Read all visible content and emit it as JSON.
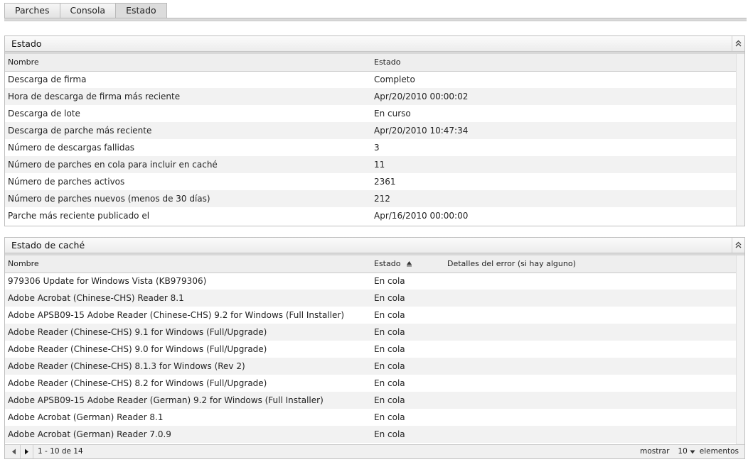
{
  "tabs": [
    {
      "label": "Parches",
      "active": false
    },
    {
      "label": "Consola",
      "active": false
    },
    {
      "label": "Estado",
      "active": true
    }
  ],
  "status_panel": {
    "title": "Estado",
    "columns": [
      "Nombre",
      "Estado"
    ],
    "rows": [
      {
        "name": "Descarga de firma",
        "status": "Completo"
      },
      {
        "name": "Hora de descarga de firma más reciente",
        "status": "Apr/20/2010 00:00:02"
      },
      {
        "name": "Descarga de lote",
        "status": "En curso"
      },
      {
        "name": "Descarga de parche más reciente",
        "status": "Apr/20/2010 10:47:34"
      },
      {
        "name": "Número de descargas fallidas",
        "status": "3"
      },
      {
        "name": "Número de parches en cola para incluir en caché",
        "status": "11"
      },
      {
        "name": "Número de parches activos",
        "status": "2361"
      },
      {
        "name": "Número de parches nuevos (menos de 30 días)",
        "status": "212"
      },
      {
        "name": "Parche más reciente publicado el",
        "status": "Apr/16/2010 00:00:00"
      }
    ]
  },
  "cache_panel": {
    "title": "Estado de caché",
    "columns": [
      "Nombre",
      "Estado",
      "Detalles del error (si hay alguno)"
    ],
    "rows": [
      {
        "name": "979306 Update for Windows Vista (KB979306)",
        "status": "En cola",
        "error": ""
      },
      {
        "name": "Adobe Acrobat (Chinese-CHS) Reader 8.1",
        "status": "En cola",
        "error": ""
      },
      {
        "name": "Adobe APSB09-15 Adobe Reader (Chinese-CHS) 9.2 for Windows (Full Installer)",
        "status": "En cola",
        "error": ""
      },
      {
        "name": "Adobe Reader (Chinese-CHS) 9.1 for Windows (Full/Upgrade)",
        "status": "En cola",
        "error": ""
      },
      {
        "name": "Adobe Reader (Chinese-CHS) 9.0 for Windows (Full/Upgrade)",
        "status": "En cola",
        "error": ""
      },
      {
        "name": "Adobe Reader (Chinese-CHS) 8.1.3 for Windows (Rev 2)",
        "status": "En cola",
        "error": ""
      },
      {
        "name": "Adobe Reader (Chinese-CHS) 8.2 for Windows (Full/Upgrade)",
        "status": "En cola",
        "error": ""
      },
      {
        "name": "Adobe APSB09-15 Adobe Reader (German) 9.2 for Windows (Full Installer)",
        "status": "En cola",
        "error": ""
      },
      {
        "name": "Adobe Acrobat (German) Reader 8.1",
        "status": "En cola",
        "error": ""
      },
      {
        "name": "Adobe Acrobat (German) Reader 7.0.9",
        "status": "En cola",
        "error": ""
      }
    ],
    "pager": {
      "range": "1 - 10 de 14",
      "show_label": "mostrar",
      "page_size": "10",
      "items_label": "elementos"
    }
  },
  "icons": {
    "collapse": "double-chevron-up-icon",
    "sort": "sort-ascending-icon",
    "prev": "triangle-left-icon",
    "next": "triangle-right-icon",
    "dropdown": "triangle-down-icon"
  }
}
